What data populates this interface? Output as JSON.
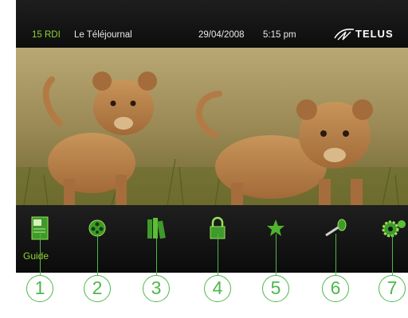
{
  "header": {
    "channel_number": "15 RDI",
    "channel_name": "Le Téléjournal",
    "date": "29/04/2008",
    "time": "5:15 pm",
    "brand": "TELUS"
  },
  "menu": {
    "selected_label": "Guide",
    "items": [
      {
        "icon": "guide-book-icon"
      },
      {
        "icon": "film-reel-icon"
      },
      {
        "icon": "library-books-icon"
      },
      {
        "icon": "padlock-icon"
      },
      {
        "icon": "star-icon"
      },
      {
        "icon": "key-icon"
      },
      {
        "icon": "gear-icon"
      }
    ]
  },
  "callouts": [
    "1",
    "2",
    "3",
    "4",
    "5",
    "6",
    "7"
  ],
  "colors": {
    "accent": "#8fd42e",
    "callout": "#4db84a",
    "background": "#141414"
  }
}
